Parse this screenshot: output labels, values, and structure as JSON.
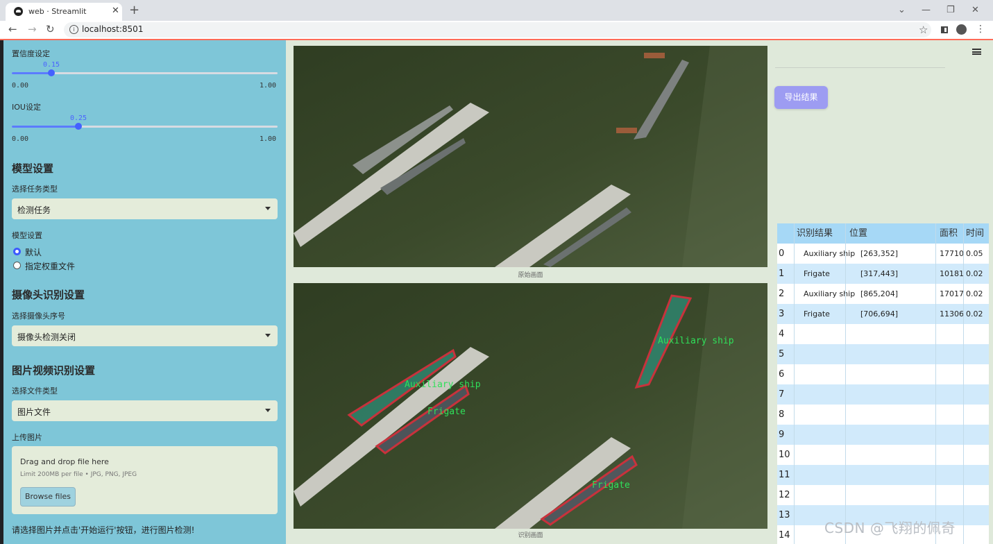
{
  "browser": {
    "tab_title": "web · Streamlit",
    "url": "localhost:8501"
  },
  "sidebar": {
    "conf_label": "置信度设定",
    "conf_value": "0.15",
    "conf_min": "0.00",
    "conf_max": "1.00",
    "conf_fraction": 0.15,
    "iou_label": "IOU设定",
    "iou_value": "0.25",
    "iou_min": "0.00",
    "iou_max": "1.00",
    "iou_fraction": 0.25,
    "model_header": "模型设置",
    "task_label": "选择任务类型",
    "task_value": "检测任务",
    "model_label": "模型设置",
    "model_options": [
      "默认",
      "指定权重文件"
    ],
    "camera_header": "摄像头识别设置",
    "camera_label": "选择摄像头序号",
    "camera_value": "摄像头检测关闭",
    "media_header": "图片视频识别设置",
    "filetype_label": "选择文件类型",
    "filetype_value": "图片文件",
    "upload_label": "上传图片",
    "drag_text": "Drag and drop file here",
    "limit_text": "Limit 200MB per file • JPG, PNG, JPEG",
    "browse_label": "Browse files",
    "status_msg": "请选择图片并点击'开始运行'按钮，进行图片检测!"
  },
  "main": {
    "orig_caption": "原始画面",
    "result_caption": "识别画面",
    "export_label": "导出结果",
    "detections": [
      {
        "label": "Auxiliary ship",
        "color": "#2fe05a"
      },
      {
        "label": "Auxiliary ship",
        "color": "#2fe05a"
      },
      {
        "label": "Frigate",
        "color": "#2fe05a"
      },
      {
        "label": "Frigate",
        "color": "#2fe05a"
      }
    ]
  },
  "table": {
    "headers": [
      "识别结果",
      "位置",
      "面积",
      "时间"
    ],
    "rows": [
      {
        "idx": "0",
        "result": "Auxiliary ship",
        "pos": "[263,352]",
        "area": "17710",
        "time": "0.05"
      },
      {
        "idx": "1",
        "result": "Frigate",
        "pos": "[317,443]",
        "area": "10181",
        "time": "0.02"
      },
      {
        "idx": "2",
        "result": "Auxiliary ship",
        "pos": "[865,204]",
        "area": "17017",
        "time": "0.02"
      },
      {
        "idx": "3",
        "result": "Frigate",
        "pos": "[706,694]",
        "area": "11306",
        "time": "0.02"
      },
      {
        "idx": "4"
      },
      {
        "idx": "5"
      },
      {
        "idx": "6"
      },
      {
        "idx": "7"
      },
      {
        "idx": "8"
      },
      {
        "idx": "9"
      },
      {
        "idx": "10"
      },
      {
        "idx": "11"
      },
      {
        "idx": "12"
      },
      {
        "idx": "13"
      },
      {
        "idx": "14"
      }
    ]
  },
  "watermark": "CSDN @飞翔的佩奇",
  "colors": {
    "sidebar_bg": "#7ec6d8",
    "main_bg": "#dfe9da",
    "accent": "#4461ff",
    "export_btn": "#9d9cf2",
    "detection_box": "#c8323c"
  }
}
